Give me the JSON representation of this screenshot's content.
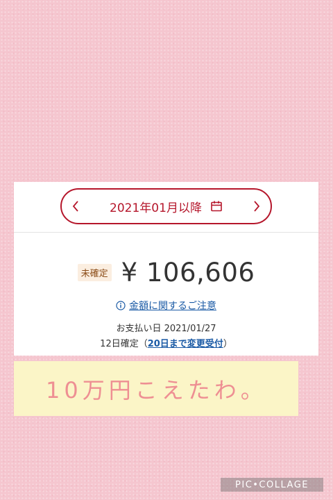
{
  "period": {
    "label": "2021年01月以降",
    "prev_icon": "chevron-left-icon",
    "next_icon": "chevron-right-icon",
    "calendar_icon": "calendar-icon"
  },
  "billing": {
    "status_badge": "未確定",
    "amount": "¥ 106,606",
    "notice_link": "金額に関するご注意",
    "notice_icon": "info-icon",
    "payment_date": "お支払い日 2021/01/27",
    "confirm_prefix": "12日確定（",
    "confirm_link": "20日まで変更受付",
    "confirm_suffix": "）"
  },
  "caption": {
    "text": "10万円こえたわ。"
  },
  "watermark": {
    "text": "PIC•COLLAGE"
  },
  "colors": {
    "background": "#f5c6cf",
    "accent_red": "#b5162b",
    "link_blue": "#1a5aa5",
    "badge_bg": "#fbeee0",
    "caption_bg": "#fbf5c7",
    "caption_text": "#ee8f93"
  }
}
